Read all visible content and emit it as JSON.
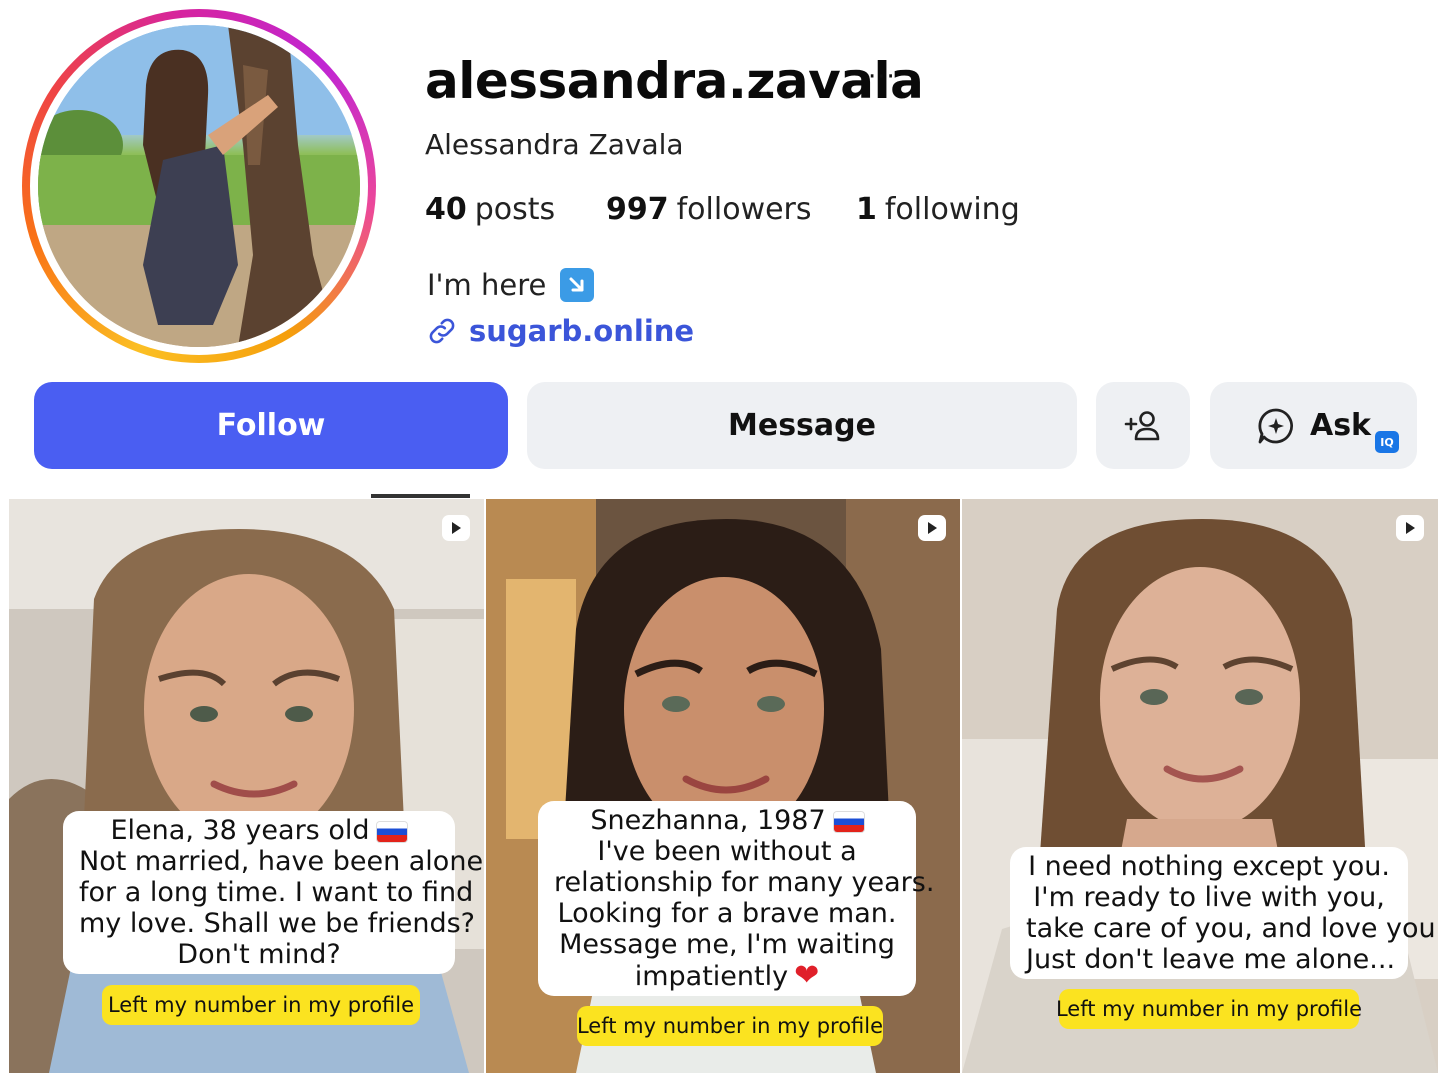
{
  "profile": {
    "username": "alessandra.zavala",
    "more_label": "···",
    "full_name": "Alessandra Zavala",
    "stats": {
      "posts_count": "40",
      "posts_label": "posts",
      "followers_count": "997",
      "followers_label": "followers",
      "following_count": "1",
      "following_label": "following"
    },
    "bio": "I'm here",
    "bio_emoji_icon": "arrow-down-right-emoji",
    "link": "sugarb.online"
  },
  "actions": {
    "follow_label": "Follow",
    "message_label": "Message",
    "add_user_icon": "add-user-icon",
    "ask_label": "Ask",
    "ask_badge": "IQ"
  },
  "posts": [
    {
      "lines": [
        "Elena, 38 years old",
        "Not married, have been alone",
        "for a long time. I want to find",
        "my love. Shall we be friends?",
        "Don't mind?"
      ],
      "cta": "Left my number in my profile"
    },
    {
      "lines": [
        "Snezhanna, 1987",
        "I've been without a",
        "relationship for many years.",
        "Looking for a brave man.",
        "Message me, I'm waiting",
        "impatiently"
      ],
      "cta": "Left my number in my profile"
    },
    {
      "lines": [
        "I need nothing except you.",
        "I'm ready to live with you,",
        "take care of you, and love you.",
        "Just don't leave me alone..."
      ],
      "cta": "Left my number in my profile"
    }
  ],
  "colors": {
    "follow_button": "#4a5ef2",
    "link": "#3b55d9",
    "cta_yellow": "#fbe320"
  }
}
